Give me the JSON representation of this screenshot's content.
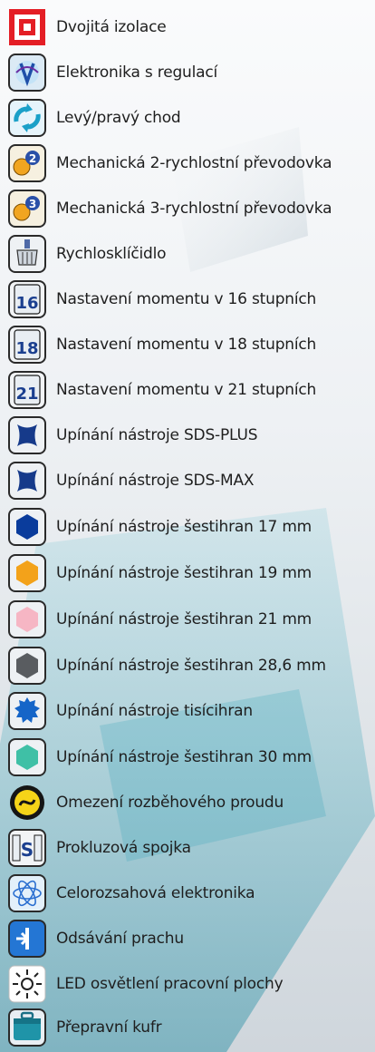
{
  "items": [
    {
      "label": "Dvojitá izolace",
      "icon": "double-insulation-icon"
    },
    {
      "label": "Elektronika s regulací",
      "icon": "electronic-regulation-icon"
    },
    {
      "label": "Levý/pravý chod",
      "icon": "reverse-rotation-icon"
    },
    {
      "label": "Mechanická 2-rychlostní převodovka",
      "icon": "two-speed-gearbox-icon"
    },
    {
      "label": "Mechanická 3-rychlostní převodovka",
      "icon": "three-speed-gearbox-icon"
    },
    {
      "label": "Rychlosklíčidlo",
      "icon": "keyless-chuck-icon"
    },
    {
      "label": "Nastavení momentu v 16 stupních",
      "icon": "torque-16-icon",
      "badge": "16"
    },
    {
      "label": "Nastavení momentu v 18 stupních",
      "icon": "torque-18-icon",
      "badge": "18"
    },
    {
      "label": "Nastavení momentu v 21 stupních",
      "icon": "torque-21-icon",
      "badge": "21"
    },
    {
      "label": "Upínání nástroje SDS-PLUS",
      "icon": "sds-plus-icon"
    },
    {
      "label": "Upínání nástroje SDS-MAX",
      "icon": "sds-max-icon"
    },
    {
      "label": "Upínání nástroje šestihran 17 mm",
      "icon": "hex-17-icon",
      "color": "#0a3c9c"
    },
    {
      "label": "Upínání nástroje šestihran 19 mm",
      "icon": "hex-19-icon",
      "color": "#f3a21a"
    },
    {
      "label": "Upínání nástroje šestihran 21 mm",
      "icon": "hex-21-icon",
      "color": "#f6b6c4"
    },
    {
      "label": "Upínání nástroje šestihran 28,6 mm",
      "icon": "hex-28-6-icon",
      "color": "#595c60"
    },
    {
      "label": "Upínání nástroje tisícihran",
      "icon": "thousand-hex-icon",
      "color": "#1565c8"
    },
    {
      "label": "Upínání nástroje šestihran 30 mm",
      "icon": "hex-30-icon",
      "color": "#3fc0a6"
    },
    {
      "label": "Omezení rozběhového proudu",
      "icon": "soft-start-icon"
    },
    {
      "label": "Prokluzová spojka",
      "icon": "slip-clutch-icon",
      "badge": "S"
    },
    {
      "label": "Celorozsahová elektronika",
      "icon": "full-range-electronics-icon"
    },
    {
      "label": "Odsávání prachu",
      "icon": "dust-extraction-icon"
    },
    {
      "label": "LED osvětlení pracovní plochy",
      "icon": "led-light-icon"
    },
    {
      "label": "Přepravní kufr",
      "icon": "carry-case-icon"
    }
  ]
}
